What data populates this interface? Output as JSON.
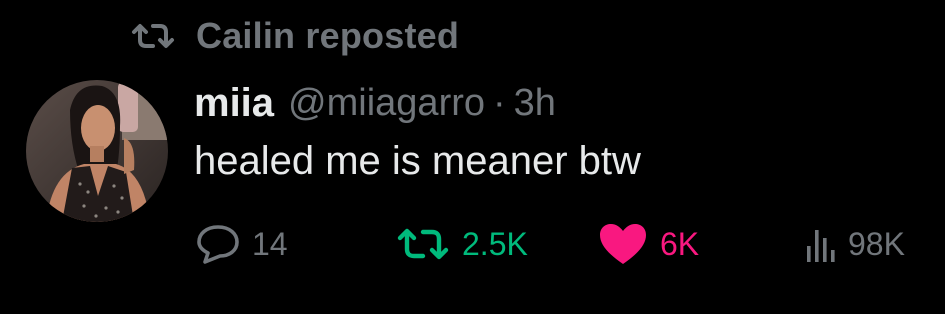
{
  "repost_banner": {
    "icon": "repost-icon",
    "text": "Cailin reposted"
  },
  "post": {
    "avatar_icon": "user-avatar",
    "display_name": "miia",
    "handle": "@miiagarro",
    "separator": "·",
    "time": "3h",
    "text": "healed me is meaner btw"
  },
  "actions": {
    "reply": {
      "icon": "reply-icon",
      "count": "14"
    },
    "repost": {
      "icon": "repost-icon",
      "count": "2.5K",
      "active": true
    },
    "like": {
      "icon": "heart-icon",
      "count": "6K",
      "active": true
    },
    "views": {
      "icon": "views-icon",
      "count": "98K"
    }
  },
  "colors": {
    "background": "#000000",
    "primary_text": "#e7e9ea",
    "secondary_text": "#71767b",
    "repost_green": "#00ba7c",
    "like_pink": "#f91880"
  }
}
